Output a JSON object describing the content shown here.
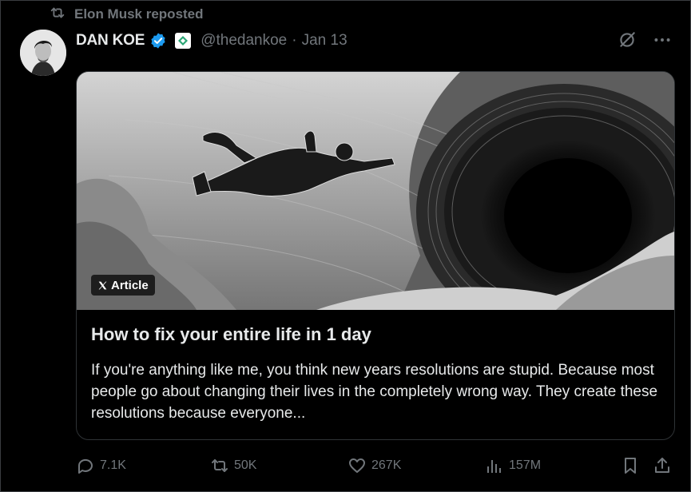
{
  "repost": {
    "text": "Elon Musk reposted"
  },
  "author": {
    "name": "DAN KOE",
    "handle": "@thedankoe",
    "separator": "·",
    "date": "Jan 13"
  },
  "card": {
    "badge": "Article",
    "title": "How to fix your entire life in 1 day",
    "description": "If you're anything like me, you think new years resolutions are stupid. Because most people go about changing their lives in the completely wrong way. They create these resolutions because everyone..."
  },
  "actions": {
    "replies": "7.1K",
    "reposts": "50K",
    "likes": "267K",
    "views": "157M"
  },
  "colors": {
    "background": "#000000",
    "text": "#e7e9ea",
    "muted": "#71767b",
    "verified": "#1d9bf0",
    "border": "#2f3336"
  },
  "icons": {
    "repost": "repost-icon",
    "verified": "verified-badge-icon",
    "affiliate": "affiliate-badge-icon",
    "grok": "grok-icon",
    "more": "more-icon",
    "x_logo": "x-logo-icon",
    "reply": "reply-icon",
    "like": "heart-icon",
    "views": "views-icon",
    "bookmark": "bookmark-icon",
    "share": "share-icon"
  }
}
